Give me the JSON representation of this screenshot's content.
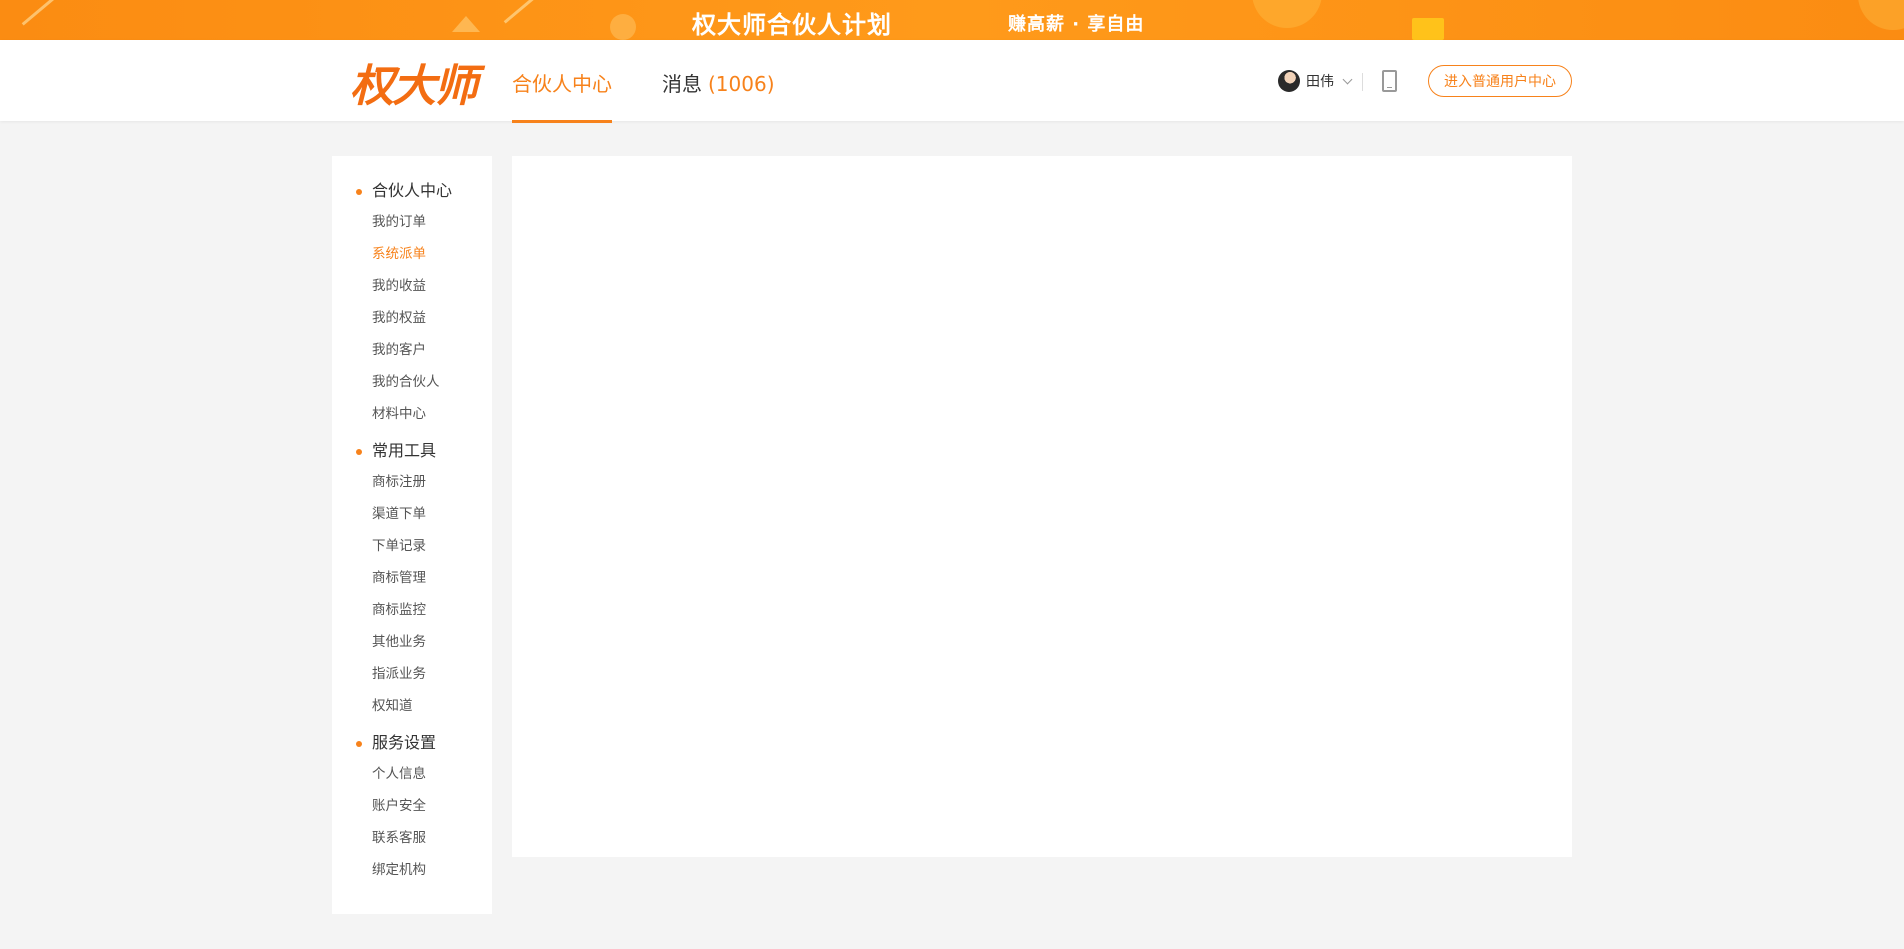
{
  "banner": {
    "title": "权大师合伙人计划",
    "subtitle": "赚高薪 · 享自由"
  },
  "header": {
    "logo": "权大师",
    "tabs": [
      {
        "label": "合伙人中心",
        "active": true
      },
      {
        "label": "消息",
        "count": "(1006)",
        "active": false
      }
    ],
    "user_name": "田伟",
    "phone_icon": "phone-icon",
    "enter_button": "进入普通用户中心"
  },
  "sidebar": {
    "groups": [
      {
        "title": "合伙人中心",
        "items": [
          "我的订单",
          "系统派单",
          "我的收益",
          "我的权益",
          "我的客户",
          "我的合伙人",
          "材料中心"
        ]
      },
      {
        "title": "常用工具",
        "items": [
          "商标注册",
          "渠道下单",
          "下单记录",
          "商标管理",
          "商标监控",
          "其他业务",
          "指派业务",
          "权知道"
        ]
      },
      {
        "title": "服务设置",
        "items": [
          "个人信息",
          "账户安全",
          "联系客服",
          "绑定机构"
        ]
      }
    ],
    "active_item": "系统派单"
  },
  "colors": {
    "accent": "#f7821b",
    "banner": "#fb8c12",
    "background": "#f4f4f4"
  }
}
